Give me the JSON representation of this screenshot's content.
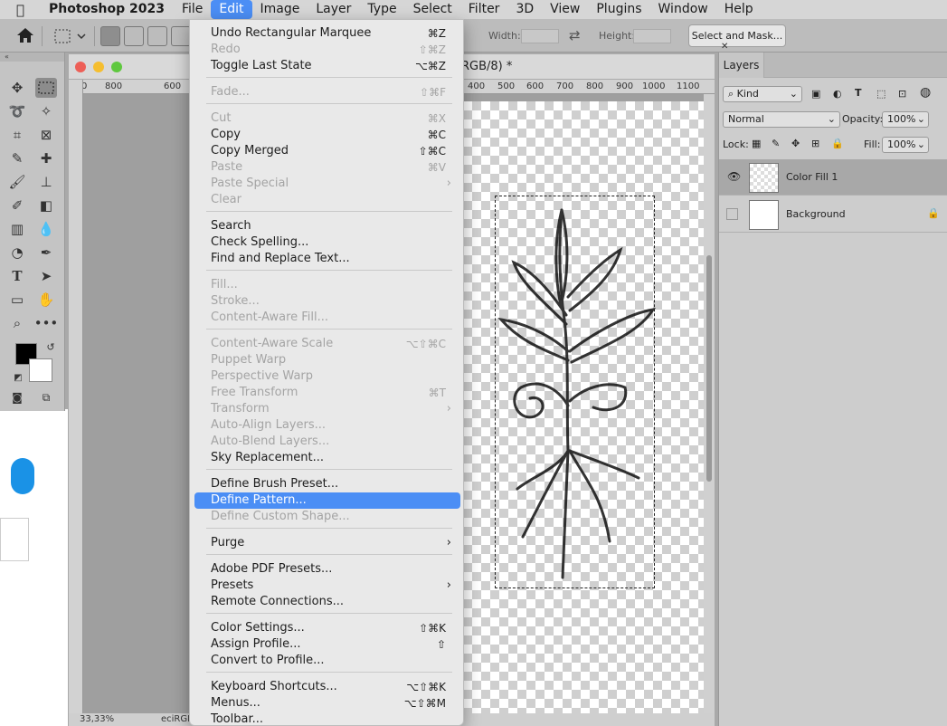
{
  "menubar": {
    "app": "Photoshop 2023",
    "items": [
      "File",
      "Edit",
      "Image",
      "Layer",
      "Type",
      "Select",
      "Filter",
      "3D",
      "View",
      "Plugins",
      "Window",
      "Help"
    ]
  },
  "options": {
    "width_label": "Width:",
    "height_label": "Height:",
    "select_mask": "Select and Mask..."
  },
  "document": {
    "title_fragment": "RGB/8) *",
    "ruler_ticks": [
      "800",
      "600",
      "400",
      "500",
      "600",
      "700",
      "800",
      "900",
      "1000",
      "1100"
    ],
    "zoom": "33,33%",
    "profile": "eciRGB"
  },
  "layers": {
    "tab": "Layers",
    "kind": "Kind",
    "blend_mode": "Normal",
    "opacity_label": "Opacity:",
    "opacity": "100%",
    "lock_label": "Lock:",
    "fill_label": "Fill:",
    "fill": "100%",
    "rows": [
      {
        "name": "Color Fill 1",
        "selected": true,
        "visible": true
      },
      {
        "name": "Background",
        "selected": false,
        "visible": false
      }
    ]
  },
  "edit_menu": {
    "items": [
      {
        "label": "Undo Rectangular Marquee",
        "shortcut": "⌘Z",
        "disabled": false
      },
      {
        "label": "Redo",
        "shortcut": "⇧⌘Z",
        "disabled": true
      },
      {
        "label": "Toggle Last State",
        "shortcut": "⌥⌘Z",
        "disabled": false
      },
      {
        "label": "Fade...",
        "shortcut": "⇧⌘F",
        "disabled": true
      },
      {
        "label": "Cut",
        "shortcut": "⌘X",
        "disabled": true
      },
      {
        "label": "Copy",
        "shortcut": "⌘C",
        "disabled": false
      },
      {
        "label": "Copy Merged",
        "shortcut": "⇧⌘C",
        "disabled": false
      },
      {
        "label": "Paste",
        "shortcut": "⌘V",
        "disabled": true
      },
      {
        "label": "Paste Special",
        "shortcut": "",
        "disabled": true,
        "submenu": true
      },
      {
        "label": "Clear",
        "shortcut": "",
        "disabled": true
      },
      {
        "label": "Search",
        "shortcut": "",
        "disabled": false
      },
      {
        "label": "Check Spelling...",
        "shortcut": "",
        "disabled": false
      },
      {
        "label": "Find and Replace Text...",
        "shortcut": "",
        "disabled": false
      },
      {
        "label": "Fill...",
        "shortcut": "",
        "disabled": true
      },
      {
        "label": "Stroke...",
        "shortcut": "",
        "disabled": true
      },
      {
        "label": "Content-Aware Fill...",
        "shortcut": "",
        "disabled": true
      },
      {
        "label": "Content-Aware Scale",
        "shortcut": "⌥⇧⌘C",
        "disabled": true
      },
      {
        "label": "Puppet Warp",
        "shortcut": "",
        "disabled": true
      },
      {
        "label": "Perspective Warp",
        "shortcut": "",
        "disabled": true
      },
      {
        "label": "Free Transform",
        "shortcut": "⌘T",
        "disabled": true
      },
      {
        "label": "Transform",
        "shortcut": "",
        "disabled": true,
        "submenu": true
      },
      {
        "label": "Auto-Align Layers...",
        "shortcut": "",
        "disabled": true
      },
      {
        "label": "Auto-Blend Layers...",
        "shortcut": "",
        "disabled": true
      },
      {
        "label": "Sky Replacement...",
        "shortcut": "",
        "disabled": false
      },
      {
        "label": "Define Brush Preset...",
        "shortcut": "",
        "disabled": false
      },
      {
        "label": "Define Pattern...",
        "shortcut": "",
        "disabled": false,
        "highlighted": true
      },
      {
        "label": "Define Custom Shape...",
        "shortcut": "",
        "disabled": true
      },
      {
        "label": "Purge",
        "shortcut": "",
        "disabled": false,
        "submenu": true
      },
      {
        "label": "Adobe PDF Presets...",
        "shortcut": "",
        "disabled": false
      },
      {
        "label": "Presets",
        "shortcut": "",
        "disabled": false,
        "submenu": true
      },
      {
        "label": "Remote Connections...",
        "shortcut": "",
        "disabled": false
      },
      {
        "label": "Color Settings...",
        "shortcut": "⇧⌘K",
        "disabled": false
      },
      {
        "label": "Assign Profile...",
        "shortcut": "⇧",
        "disabled": false
      },
      {
        "label": "Convert to Profile...",
        "shortcut": "",
        "disabled": false
      },
      {
        "label": "Keyboard Shortcuts...",
        "shortcut": "⌥⇧⌘K",
        "disabled": false
      },
      {
        "label": "Menus...",
        "shortcut": "⌥⇧⌘M",
        "disabled": false
      },
      {
        "label": "Toolbar...",
        "shortcut": "",
        "disabled": false
      }
    ]
  },
  "colors": {
    "accent": "#4b8ef5",
    "menu_bg": "#e9e9e9",
    "disabled_text": "#a4a4a4"
  }
}
